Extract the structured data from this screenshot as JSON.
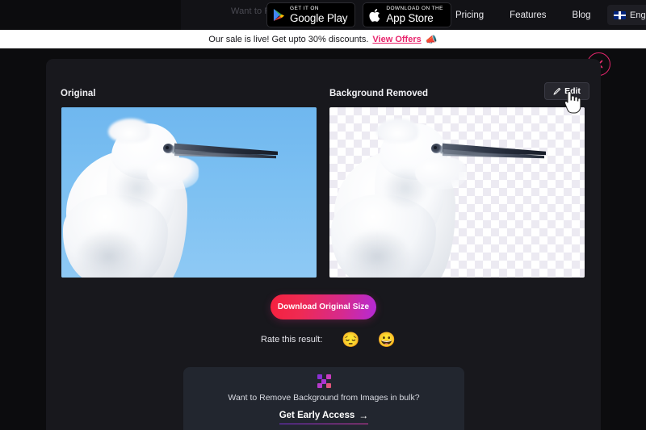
{
  "nav": {
    "promo_text": "Want to Remove Background",
    "store_badges": [
      {
        "id": "google-play",
        "small": "GET IT ON",
        "big": "Google Play"
      },
      {
        "id": "app-store",
        "small": "Download on the",
        "big": "App Store"
      }
    ],
    "links": [
      "Pricing",
      "Features",
      "Blog"
    ],
    "language": "English",
    "language_flag": "uk-flag-icon"
  },
  "banner": {
    "text": "Our sale is live! Get upto 30% discounts.",
    "link": "View Offers",
    "emoji": "📣",
    "bg": "#ffffff",
    "link_color": "#e8246c"
  },
  "modal": {
    "close_label": "close-icon",
    "panels": {
      "original_label": "Original",
      "removed_label": "Background Removed"
    },
    "edit_button": "Edit",
    "download_button": "Download Original Size",
    "download_gradient": [
      "#f5213f",
      "#b52ad6"
    ],
    "rate": {
      "label": "Rate this result:",
      "options": [
        "😔",
        "😀"
      ]
    },
    "bulk": {
      "question": "Want to Remove Background from Images in bulk?",
      "cta": "Get Early Access",
      "arrow": "→"
    }
  }
}
